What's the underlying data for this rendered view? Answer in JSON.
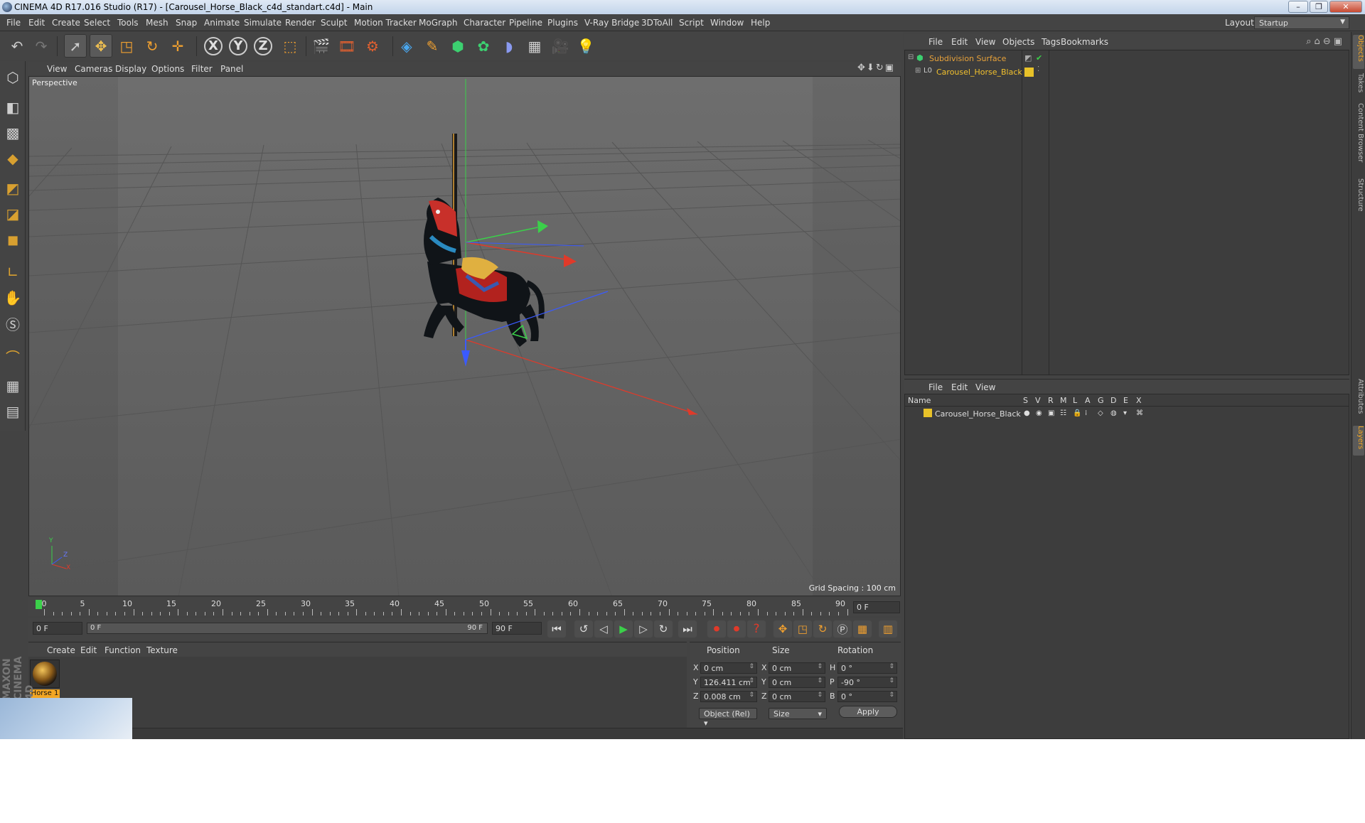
{
  "window": {
    "title": "CINEMA 4D R17.016 Studio (R17) - [Carousel_Horse_Black_c4d_standart.c4d] - Main",
    "controls": [
      "–",
      "❐",
      "✕"
    ]
  },
  "menubar": {
    "items": [
      "File",
      "Edit",
      "Create",
      "Select",
      "Tools",
      "Mesh",
      "Snap",
      "Animate",
      "Simulate",
      "Render",
      "Sculpt",
      "Motion Tracker",
      "MoGraph",
      "Character",
      "Pipeline",
      "Plugins",
      "V-Ray Bridge",
      "3DToAll",
      "Script",
      "Window",
      "Help"
    ],
    "layout_label": "Layout:",
    "layout_value": "Startup"
  },
  "toolbar": {
    "xyz": [
      "X",
      "Y",
      "Z"
    ]
  },
  "viewport": {
    "menu": [
      "View",
      "Cameras",
      "Display",
      "Options",
      "Filter",
      "Panel"
    ],
    "label": "Perspective",
    "grid_spacing": "Grid Spacing : 100 cm",
    "axis_labels": [
      "Y",
      "X",
      "Z"
    ]
  },
  "timeline": {
    "ticks": [
      "0",
      "5",
      "10",
      "15",
      "20",
      "25",
      "30",
      "35",
      "40",
      "45",
      "50",
      "55",
      "60",
      "65",
      "70",
      "75",
      "80",
      "85",
      "90"
    ],
    "current_frame": "0 F",
    "end_field": "0 F"
  },
  "transport": {
    "start": "0 F",
    "range_start": "0 F",
    "range_end": "90 F",
    "end": "90 F"
  },
  "material_manager": {
    "menu": [
      "Create",
      "Edit",
      "Function",
      "Texture"
    ],
    "material_name": "Horse 1",
    "side_logo": "MAXON CINEMA 4D"
  },
  "coordinates": {
    "headers": [
      "Position",
      "Size",
      "Rotation"
    ],
    "rows": [
      {
        "axis": "X",
        "pos": "0 cm",
        "size_axis": "X",
        "size": "0 cm",
        "rot_axis": "H",
        "rot": "0 °"
      },
      {
        "axis": "Y",
        "pos": "126.411 cm",
        "size_axis": "Y",
        "size": "0 cm",
        "rot_axis": "P",
        "rot": "-90 °"
      },
      {
        "axis": "Z",
        "pos": "0.008 cm",
        "size_axis": "Z",
        "size": "0 cm",
        "rot_axis": "B",
        "rot": "0 °"
      }
    ],
    "mode": "Object (Rel)",
    "size_mode": "Size",
    "apply": "Apply"
  },
  "object_manager": {
    "menu": [
      "File",
      "Edit",
      "View",
      "Objects",
      "Tags",
      "Bookmarks"
    ],
    "objects": [
      {
        "name": "Subdivision Surface",
        "color": "#e8a23a"
      },
      {
        "name": "Carousel_Horse_Black",
        "color": "#f2c12e"
      }
    ]
  },
  "layer_manager": {
    "menu": [
      "File",
      "Edit",
      "View"
    ],
    "header_name": "Name",
    "columns": [
      "S",
      "V",
      "R",
      "M",
      "L",
      "A",
      "G",
      "D",
      "E",
      "X"
    ],
    "layers": [
      {
        "name": "Carousel_Horse_Black",
        "color": "#e8c229"
      }
    ]
  },
  "right_tabs": [
    "Objects",
    "Takes",
    "Content Browser",
    "Structure",
    "Attributes",
    "Layers"
  ],
  "colors": {
    "accent": "#f2a624",
    "axis_x": "#e03a2a",
    "axis_y": "#3bd04a",
    "axis_z": "#3a5aff"
  }
}
